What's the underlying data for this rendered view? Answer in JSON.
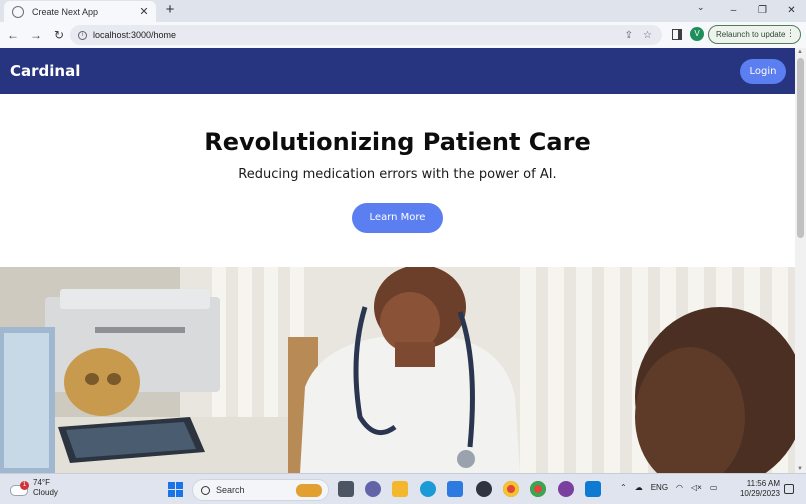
{
  "browser": {
    "tab_title": "Create Next App",
    "new_tab": "+",
    "tab_close": "✕",
    "url": "localhost:3000/home",
    "profile_initial": "V",
    "relaunch_label": "Relaunch to update",
    "win_minimize": "–",
    "win_restore": "❐",
    "win_close": "✕",
    "tab_search": "⌄"
  },
  "site": {
    "brand": "Cardinal",
    "login_label": "Login",
    "hero_title": "Revolutionizing Patient Care",
    "hero_subtitle": "Reducing medication errors with the power of AI.",
    "cta_label": "Learn More"
  },
  "taskbar": {
    "weather_temp": "74°F",
    "weather_desc": "Cloudy",
    "weather_badge": "1",
    "search_label": "Search",
    "lang": "ENG",
    "time": "11:56 AM",
    "date": "10/29/2023"
  },
  "colors": {
    "navbar": "#27347f",
    "button": "#5b7ef0"
  }
}
